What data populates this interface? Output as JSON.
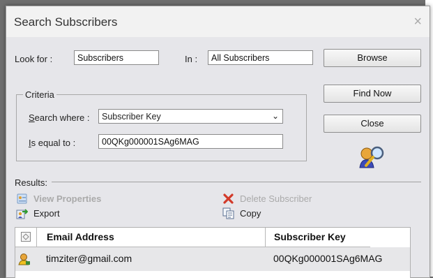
{
  "dialog": {
    "title": "Search Subscribers",
    "close_glyph": "×"
  },
  "search": {
    "look_for_label": "Look for :",
    "look_for_value": "Subscribers",
    "in_label": "In :",
    "in_value": "All Subscribers"
  },
  "buttons": {
    "browse": "Browse",
    "find_now": "Find Now",
    "close": "Close"
  },
  "criteria": {
    "legend": "Criteria",
    "search_where_label": "Search where :",
    "search_where_value": "Subscriber Key",
    "equal_to_label": "Is equal to :",
    "equal_to_value": "00QKg000001SAg6MAG"
  },
  "results": {
    "label": "Results:",
    "actions": {
      "view_properties": "View Properties",
      "delete_subscriber": "Delete Subscriber",
      "export": "Export",
      "copy": "Copy"
    },
    "columns": [
      "Email Address",
      "Subscriber Key"
    ],
    "rows": [
      {
        "email": "timziter@gmail.com",
        "key": "00QKg000001SAg6MAG"
      }
    ]
  },
  "icons": {
    "search_person": "search-person-icon",
    "view_properties": "properties-icon",
    "delete": "delete-x-icon",
    "export": "export-icon",
    "copy": "copy-icon",
    "subscriber": "subscriber-icon",
    "select_all": "select-all-icon"
  },
  "colors": {
    "dialog_bg": "#e6e6ea",
    "titlebar_bg": "#f2f2f2",
    "disabled_text": "#aaaaaa",
    "delete_red": "#d23a2a",
    "selected_row": "#e7e7e9"
  }
}
